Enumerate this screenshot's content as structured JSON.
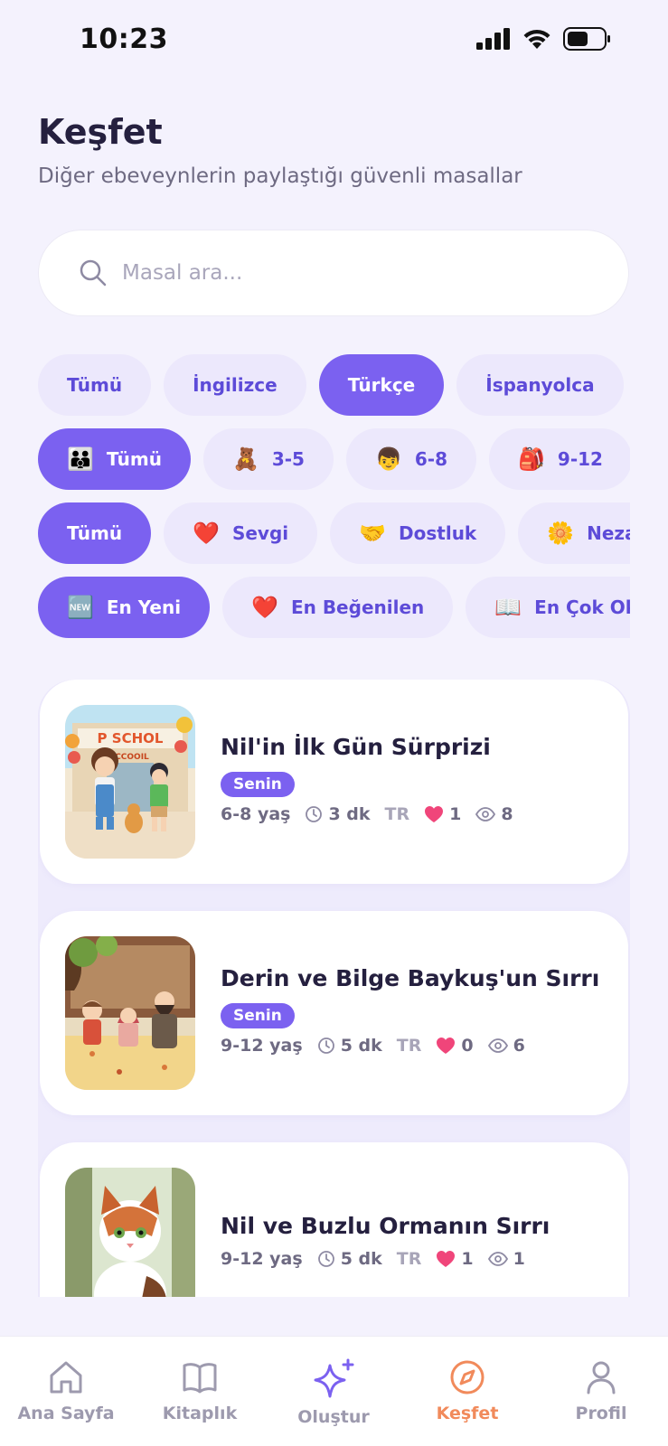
{
  "status_bar": {
    "time": "10:23"
  },
  "header": {
    "title": "Keşfet",
    "subtitle": "Diğer ebeveynlerin paylaştığı güvenli masallar"
  },
  "search": {
    "placeholder": "Masal ara..."
  },
  "language_filters": [
    {
      "label": "Tümü",
      "active": false
    },
    {
      "label": "İngilizce",
      "active": false
    },
    {
      "label": "Türkçe",
      "active": true
    },
    {
      "label": "İspanyolca",
      "active": false
    }
  ],
  "age_filters": [
    {
      "emoji": "👪",
      "label": "Tümü",
      "active": true
    },
    {
      "emoji": "🧸",
      "label": "3-5",
      "active": false
    },
    {
      "emoji": "👦",
      "label": "6-8",
      "active": false
    },
    {
      "emoji": "🎒",
      "label": "9-12",
      "active": false
    }
  ],
  "theme_filters": [
    {
      "emoji": "",
      "label": "Tümü",
      "active": true
    },
    {
      "emoji": "❤️",
      "label": "Sevgi",
      "active": false
    },
    {
      "emoji": "🤝",
      "label": "Dostluk",
      "active": false
    },
    {
      "emoji": "🌼",
      "label": "Nezaket",
      "active": false
    }
  ],
  "sort_filters": [
    {
      "emoji": "🆕",
      "label": "En Yeni",
      "active": true
    },
    {
      "emoji": "❤️",
      "label": "En Beğenilen",
      "active": false
    },
    {
      "emoji": "📖",
      "label": "En Çok Okunan",
      "active": false
    }
  ],
  "stories": [
    {
      "title": "Nil'in İlk Gün Sürprizi",
      "badge": "Senin",
      "age": "6-8 yaş",
      "duration": "3 dk",
      "lang": "TR",
      "likes": "1",
      "views": "8"
    },
    {
      "title": "Derin ve Bilge Baykuş'un Sırrı",
      "badge": "Senin",
      "age": "9-12 yaş",
      "duration": "5 dk",
      "lang": "TR",
      "likes": "0",
      "views": "6"
    },
    {
      "title": "Nil ve Buzlu Ormanın Sırrı",
      "badge": "",
      "age": "9-12 yaş",
      "duration": "5 dk",
      "lang": "TR",
      "likes": "1",
      "views": "1"
    }
  ],
  "thumb_text": {
    "school_sign_1": "P SCHOL",
    "school_sign_2": "CCOOIL"
  },
  "tabbar": {
    "items": [
      {
        "label": "Ana Sayfa",
        "icon": "home-icon"
      },
      {
        "label": "Kitaplık",
        "icon": "book-icon"
      },
      {
        "label": "Oluştur",
        "icon": "sparkle-icon"
      },
      {
        "label": "Keşfet",
        "icon": "compass-icon"
      },
      {
        "label": "Profil",
        "icon": "user-icon"
      }
    ],
    "active": "Keşfet"
  },
  "colors": {
    "accent": "#7B61F0",
    "chip_bg": "#ECE8FC",
    "active_tab": "#F18A5B",
    "heart": "#F0457A"
  }
}
